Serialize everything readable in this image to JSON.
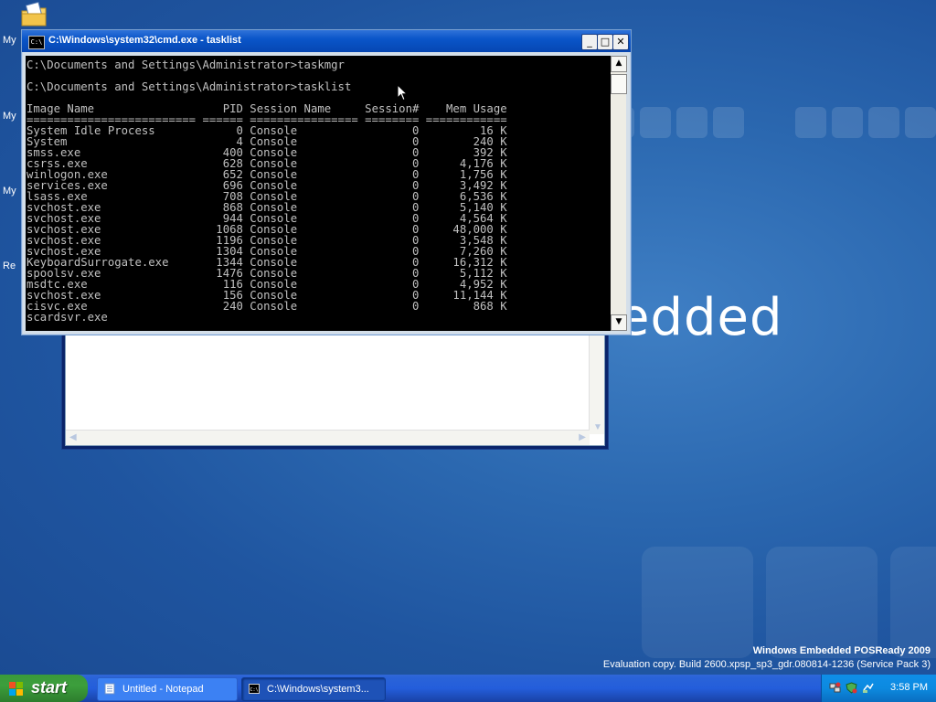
{
  "desktop": {
    "icon_labels": [
      "My",
      "My",
      "My",
      "Re"
    ],
    "watermark_brand_bg": "edded",
    "watermark_title": "Windows Embedded POSReady 2009",
    "watermark_build": "Evaluation copy. Build 2600.xpsp_sp3_gdr.080814-1236 (Service Pack 3)"
  },
  "cmd_window": {
    "title": "C:\\Windows\\system32\\cmd.exe - tasklist",
    "icon_text": "C:\\",
    "buttons": {
      "minimize": "_",
      "maximize": "□",
      "close": "✕"
    },
    "console_text": "C:\\Documents and Settings\\Administrator>taskmgr\n\nC:\\Documents and Settings\\Administrator>tasklist\n\nImage Name                   PID Session Name     Session#    Mem Usage\n========================= ====== ================ ======== ============\nSystem Idle Process            0 Console                 0         16 K\nSystem                         4 Console                 0        240 K\nsmss.exe                     400 Console                 0        392 K\ncsrss.exe                    628 Console                 0      4,176 K\nwinlogon.exe                 652 Console                 0      1,756 K\nservices.exe                 696 Console                 0      3,492 K\nlsass.exe                    708 Console                 0      6,536 K\nsvchost.exe                  868 Console                 0      5,140 K\nsvchost.exe                  944 Console                 0      4,564 K\nsvchost.exe                 1068 Console                 0     48,000 K\nsvchost.exe                 1196 Console                 0      3,548 K\nsvchost.exe                 1304 Console                 0      7,260 K\nKeyboardSurrogate.exe       1344 Console                 0     16,312 K\nspoolsv.exe                 1476 Console                 0      5,112 K\nmsdtc.exe                    116 Console                 0      4,952 K\nsvchost.exe                  156 Console                 0     11,144 K\ncisvc.exe                    240 Console                 0        868 K\nscardsvr.exe"
  },
  "taskbar": {
    "start_label": "start",
    "items": [
      {
        "label": "Untitled - Notepad",
        "active": false
      },
      {
        "label": "C:\\Windows\\system3...",
        "active": true
      }
    ],
    "clock": "3:58 PM"
  },
  "colors": {
    "desktop_blue": "#2b68b0",
    "titlebar_blue": "#0a55c9",
    "console_bg": "#000000",
    "console_fg": "#c0c0c0",
    "start_green": "#3c9e3c"
  }
}
